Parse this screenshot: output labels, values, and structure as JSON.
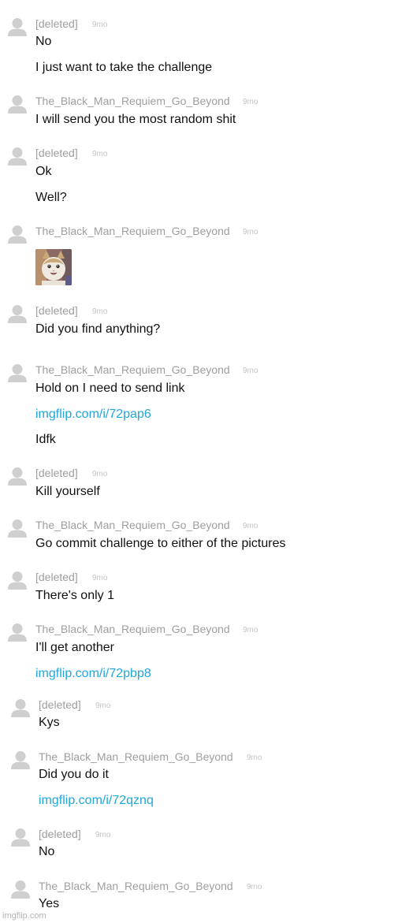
{
  "messages": [
    {
      "user": "[deleted]",
      "time": "9mo",
      "lines": [
        {
          "text": "No"
        },
        {
          "text": "I just want to take the challenge"
        }
      ]
    },
    {
      "user": "The_Black_Man_Requiem_Go_Beyond",
      "time": "9mo",
      "lines": [
        {
          "text": "I will send you the most random shit"
        }
      ]
    },
    {
      "user": "[deleted]",
      "time": "9mo",
      "lines": [
        {
          "text": "Ok"
        },
        {
          "text": "Well?"
        }
      ]
    },
    {
      "user": "The_Black_Man_Requiem_Go_Beyond",
      "time": "9mo",
      "lines": [],
      "image": "cat-photo"
    },
    {
      "user": "[deleted]",
      "time": "9mo",
      "lines": [
        {
          "text": "Did you find anything?"
        }
      ]
    },
    {
      "user": "The_Black_Man_Requiem_Go_Beyond",
      "time": "9mo",
      "lines": [
        {
          "text": "Hold on I need to send link"
        },
        {
          "text": "imgflip.com/i/72pap6",
          "link": true
        },
        {
          "text": "Idfk"
        }
      ]
    },
    {
      "user": "[deleted]",
      "time": "9mo",
      "lines": [
        {
          "text": "Kill yourself"
        }
      ]
    },
    {
      "user": "The_Black_Man_Requiem_Go_Beyond",
      "time": "9mo",
      "lines": [
        {
          "text": "Go commit challenge to either of the pictures"
        }
      ]
    },
    {
      "user": "[deleted]",
      "time": "9mo",
      "lines": [
        {
          "text": "There's only 1"
        }
      ]
    },
    {
      "user": "The_Black_Man_Requiem_Go_Beyond",
      "time": "9mo",
      "lines": [
        {
          "text": "I'll get another"
        },
        {
          "text": "imgflip.com/i/72pbp8",
          "link": true
        }
      ]
    },
    {
      "user": "[deleted]",
      "time": "9mo",
      "lines": [
        {
          "text": "Kys"
        }
      ]
    },
    {
      "user": "The_Black_Man_Requiem_Go_Beyond",
      "time": "9mo",
      "lines": [
        {
          "text": "Did you do it"
        },
        {
          "text": "imgflip.com/i/72qznq",
          "link": true
        }
      ]
    },
    {
      "user": "[deleted]",
      "time": "9mo",
      "lines": [
        {
          "text": "No"
        }
      ]
    },
    {
      "user": "The_Black_Man_Requiem_Go_Beyond",
      "time": "9mo",
      "lines": [
        {
          "text": "Yes"
        }
      ]
    }
  ],
  "watermark": "imgflip.com",
  "colors": {
    "username": "#9e9e9e",
    "time": "#c4c4c4",
    "text": "#111111",
    "link": "#1fa7da",
    "avatar": "#cfcfcf"
  }
}
